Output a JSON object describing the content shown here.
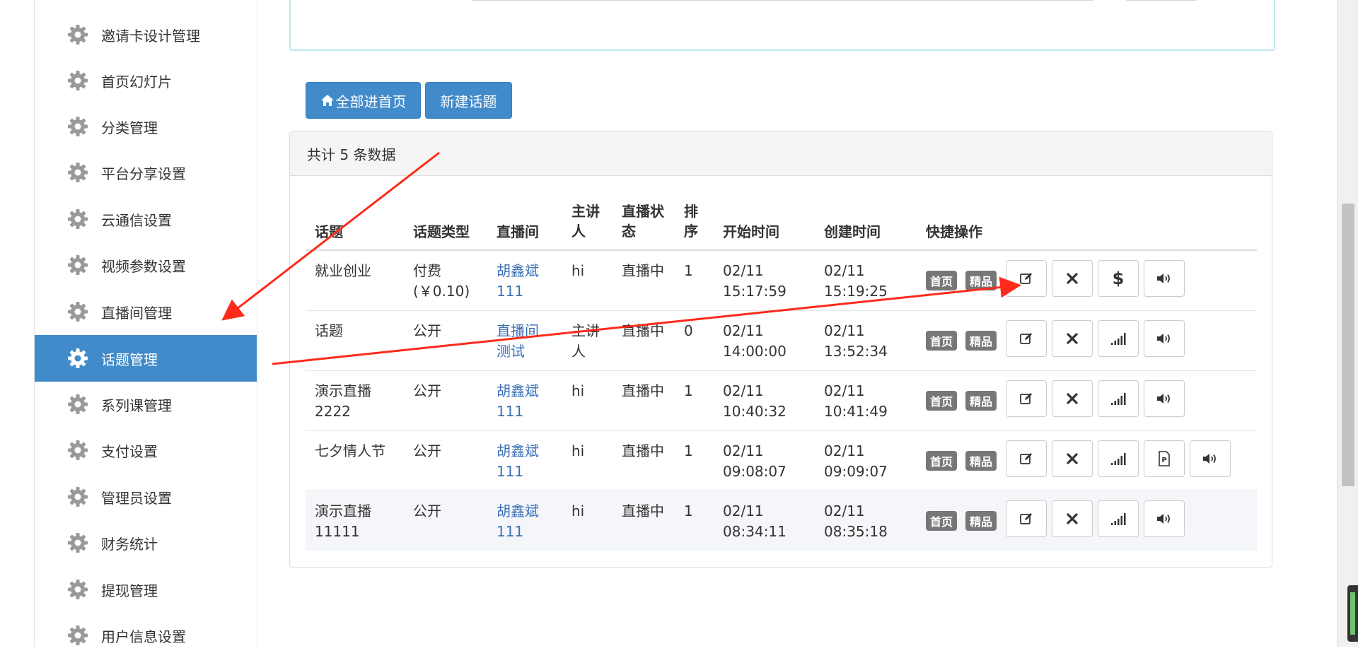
{
  "sidebar": {
    "items": [
      {
        "label": "邀请卡设计管理"
      },
      {
        "label": "首页幻灯片"
      },
      {
        "label": "分类管理"
      },
      {
        "label": "平台分享设置"
      },
      {
        "label": "云通信设置"
      },
      {
        "label": "视频参数设置"
      },
      {
        "label": "直播间管理"
      },
      {
        "label": "话题管理",
        "active": true
      },
      {
        "label": "系列课管理"
      },
      {
        "label": "支付设置"
      },
      {
        "label": "管理员设置"
      },
      {
        "label": "财务统计"
      },
      {
        "label": "提现管理"
      },
      {
        "label": "用户信息设置"
      }
    ]
  },
  "toolbar": {
    "all_home_label": "全部进首页",
    "new_topic_label": "新建话题"
  },
  "panel": {
    "heading": "共计 5 条数据"
  },
  "table": {
    "headers": {
      "topic": "话题",
      "type": "话题类型",
      "room": "直播间",
      "speaker": "主讲\n人",
      "status": "直播状\n态",
      "order": "排\n序",
      "start": "开始时间",
      "created": "创建时间",
      "actions": "快捷操作"
    },
    "rows": [
      {
        "topic": "就业创业",
        "type": "付费\n(￥0.10)",
        "room": "胡鑫斌\n111",
        "speaker": "hi",
        "status": "直播中",
        "order": "1",
        "start": "02/11\n15:17:59",
        "created": "02/11\n15:19:25",
        "badges": [
          "首页",
          "精品"
        ],
        "actions": [
          "edit-icon",
          "close-icon",
          "dollar-icon",
          "volume-icon"
        ]
      },
      {
        "topic": "话题",
        "type": "公开",
        "room": "直播间\n测试",
        "speaker": "主讲\n人",
        "status": "直播中",
        "order": "0",
        "start": "02/11\n14:00:00",
        "created": "02/11\n13:52:34",
        "badges": [
          "首页",
          "精品"
        ],
        "actions": [
          "edit-icon",
          "close-icon",
          "signal-icon",
          "volume-icon"
        ]
      },
      {
        "topic": "演示直播\n2222",
        "type": "公开",
        "room": "胡鑫斌\n111",
        "speaker": "hi",
        "status": "直播中",
        "order": "1",
        "start": "02/11\n10:40:32",
        "created": "02/11\n10:41:49",
        "badges": [
          "首页",
          "精品"
        ],
        "actions": [
          "edit-icon",
          "close-icon",
          "signal-icon",
          "volume-icon"
        ]
      },
      {
        "topic": "七夕情人节",
        "type": "公开",
        "room": "胡鑫斌\n111",
        "speaker": "hi",
        "status": "直播中",
        "order": "1",
        "start": "02/11\n09:08:07",
        "created": "02/11\n09:09:07",
        "badges": [
          "首页",
          "精品"
        ],
        "actions": [
          "edit-icon",
          "close-icon",
          "signal-icon",
          "file-p-icon",
          "volume-icon"
        ]
      },
      {
        "topic": "演示直播\n11111",
        "type": "公开",
        "room": "胡鑫斌\n111",
        "speaker": "hi",
        "status": "直播中",
        "order": "1",
        "start": "02/11\n08:34:11",
        "created": "02/11\n08:35:18",
        "badges": [
          "首页",
          "精品"
        ],
        "actions": [
          "edit-icon",
          "close-icon",
          "signal-icon",
          "volume-icon"
        ]
      }
    ]
  },
  "colors": {
    "primary": "#428bca",
    "link": "#3a6fb5",
    "badge": "#777777",
    "annotation_arrow": "#ff2a1a"
  }
}
